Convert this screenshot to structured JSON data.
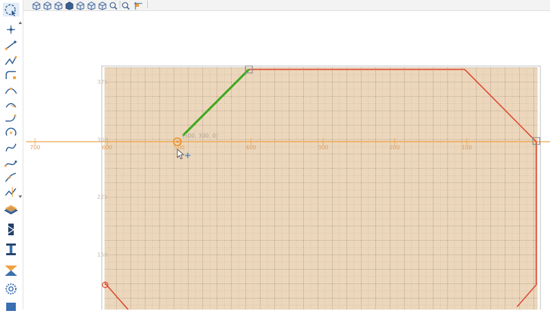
{
  "toolbar": {
    "buttons": [
      "view-iso-icon",
      "view-front-icon",
      "view-top-icon",
      "view-side-icon",
      "view-back-icon",
      "view-bottom-icon",
      "view-right-icon",
      "zoom-in-icon",
      "zoom-fit-icon",
      "snap-grid-icon"
    ]
  },
  "left_toolbar": {
    "tools": [
      "sketch-select-icon",
      "point-icon",
      "line-icon",
      "polyline-icon",
      "fillet-icon",
      "arc-three-point-icon",
      "arc-center-icon",
      "arc-tangent-icon",
      "circle-icon",
      "spline-icon",
      "bezier-icon",
      "curve-edit-icon",
      "trim-icon"
    ],
    "tools_lower": [
      "extrude-icon",
      "revolve-icon",
      "section-icon",
      "mirror-icon",
      "gear-icon",
      "material-icon"
    ]
  },
  "canvas": {
    "x_ticks": [
      "700",
      "600",
      "500",
      "400",
      "300",
      "200",
      "100"
    ],
    "y_ticks": [
      "375",
      "300",
      "225",
      "150"
    ],
    "cursor_readout": "(500, 300, 0)",
    "colors": {
      "grid_fill": "#ecd7bc",
      "grid_line": "#8a8070",
      "axis": "#f0a040",
      "axis_label": "#e0a060",
      "y_label": "#c4b8a8",
      "outline": "#e0442c",
      "construction_line": "#3ea81e",
      "snap_point": "#f08c1e"
    }
  }
}
